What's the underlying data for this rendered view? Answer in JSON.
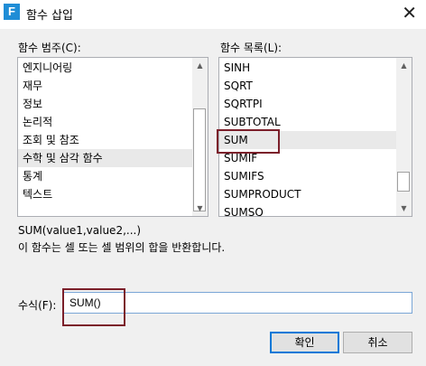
{
  "window": {
    "title": "함수 삽입",
    "app_icon_glyph": "F"
  },
  "category": {
    "label": "함수 범주(C):",
    "items": [
      "엔지니어링",
      "재무",
      "정보",
      "논리적",
      "조회 및 참조",
      "수학 및 삼각 함수",
      "통계",
      "텍스트"
    ],
    "selected": "수학 및 삼각 함수"
  },
  "functions": {
    "label": "함수 목록(L):",
    "items": [
      "SINH",
      "SQRT",
      "SQRTPI",
      "SUBTOTAL",
      "SUM",
      "SUMIF",
      "SUMIFS",
      "SUMPRODUCT",
      "SUMSQ"
    ],
    "selected": "SUM"
  },
  "description": {
    "syntax": "SUM(value1,value2,...)",
    "text": "이 함수는 셀 또는 셀 범위의 합을 반환합니다."
  },
  "formula": {
    "label": "수식(F):",
    "value": "SUM()"
  },
  "buttons": {
    "ok": "확인",
    "cancel": "취소"
  },
  "icons": {
    "close": "close-icon",
    "scroll_up": "up-arrow-icon",
    "scroll_down": "down-arrow-icon"
  },
  "colors": {
    "highlight_box": "#7b1f2a",
    "app_icon": "#1f8dd6",
    "selection": "#e9e9e9"
  }
}
